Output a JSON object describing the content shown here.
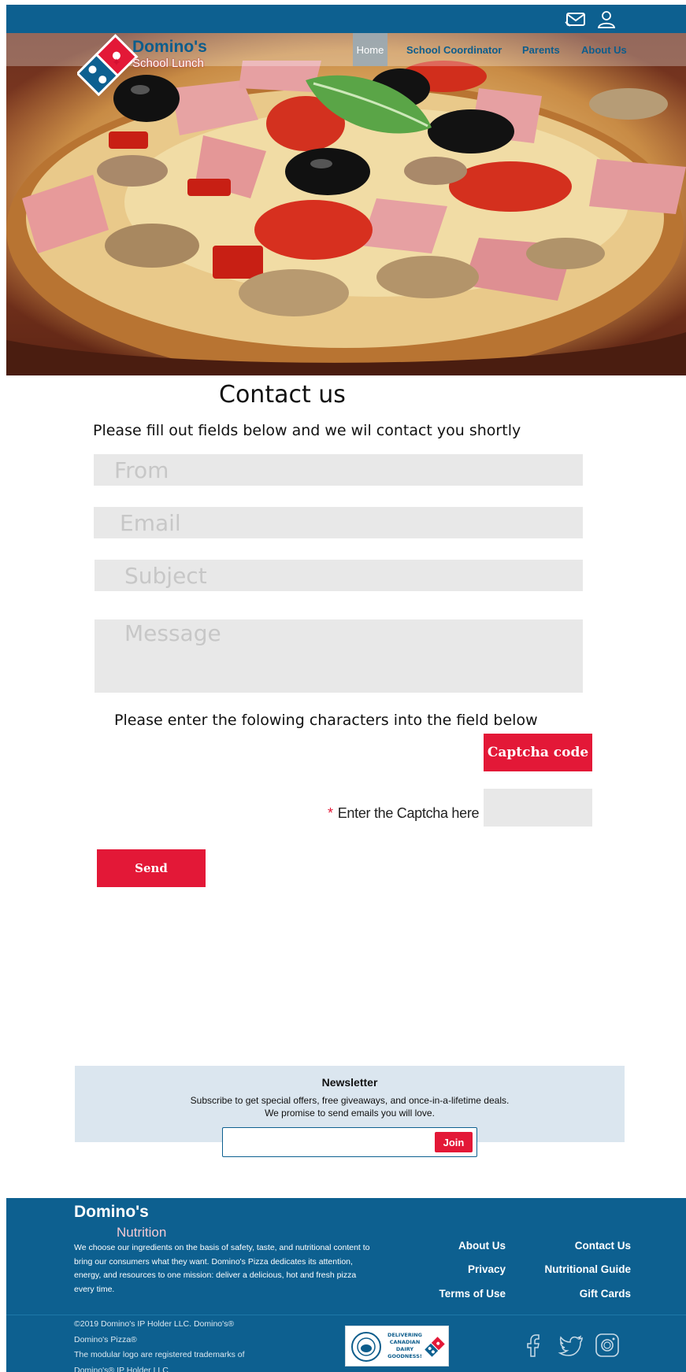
{
  "header": {
    "brand_name": "Domino's",
    "brand_sub": "School Lunch",
    "icons": [
      "mail-icon",
      "user-icon"
    ]
  },
  "nav": {
    "items": [
      {
        "label": "Home",
        "active": true
      },
      {
        "label": "School Coordinator",
        "active": false
      },
      {
        "label": "Parents",
        "active": false
      },
      {
        "label": "About Us",
        "active": false
      }
    ]
  },
  "contact": {
    "title": "Contact us",
    "intro": "Please fill out fields below and we wil contact you shortly",
    "fields": {
      "from": {
        "placeholder": "From",
        "value": ""
      },
      "email": {
        "placeholder": "Email",
        "value": ""
      },
      "subject": {
        "placeholder": "Subject",
        "value": ""
      },
      "message": {
        "placeholder": "Message",
        "value": ""
      }
    },
    "captcha_note": "Please enter the folowing characters into the field below",
    "captcha_code": "Captcha code",
    "captcha_required_mark": "*",
    "captcha_label": "Enter the Captcha here",
    "send_label": "Send"
  },
  "newsletter": {
    "title": "Newsletter",
    "line1": "Subscribe to get special offers, free giveaways, and once-in-a-lifetime deals.",
    "line2": "We promise to send emails you will love.",
    "input_value": "",
    "join_label": "Join"
  },
  "footer": {
    "brand": "Domino's",
    "nutrition": "Nutrition",
    "description": "We choose our ingredients on the basis of safety, taste, and nutritional content to bring our consumers what they want. Domino's Pizza dedicates its attention, energy, and resources to one mission: deliver a delicious, hot and fresh pizza every time.",
    "links_col1": [
      "About Us",
      "Privacy",
      "Terms of Use"
    ],
    "links_col2": [
      "Contact Us",
      "Nutritional Guide",
      "Gift Cards"
    ],
    "copyright": [
      "©2019 Domino's IP Holder LLC. Domino's®",
      "Domino's Pizza®",
      "The modular logo are registered trademarks of",
      "Domino's® IP Holder LLC"
    ],
    "badge_text": "DELIVERING CANADIAN DAIRY GOODNESS!",
    "social_icons": [
      "facebook-icon",
      "twitter-icon",
      "instagram-icon"
    ]
  },
  "colors": {
    "primary_blue": "#0d6090",
    "accent_red": "#e31837",
    "field_grey": "#e8e8e8",
    "newsletter_bg": "#dbe6ef"
  }
}
